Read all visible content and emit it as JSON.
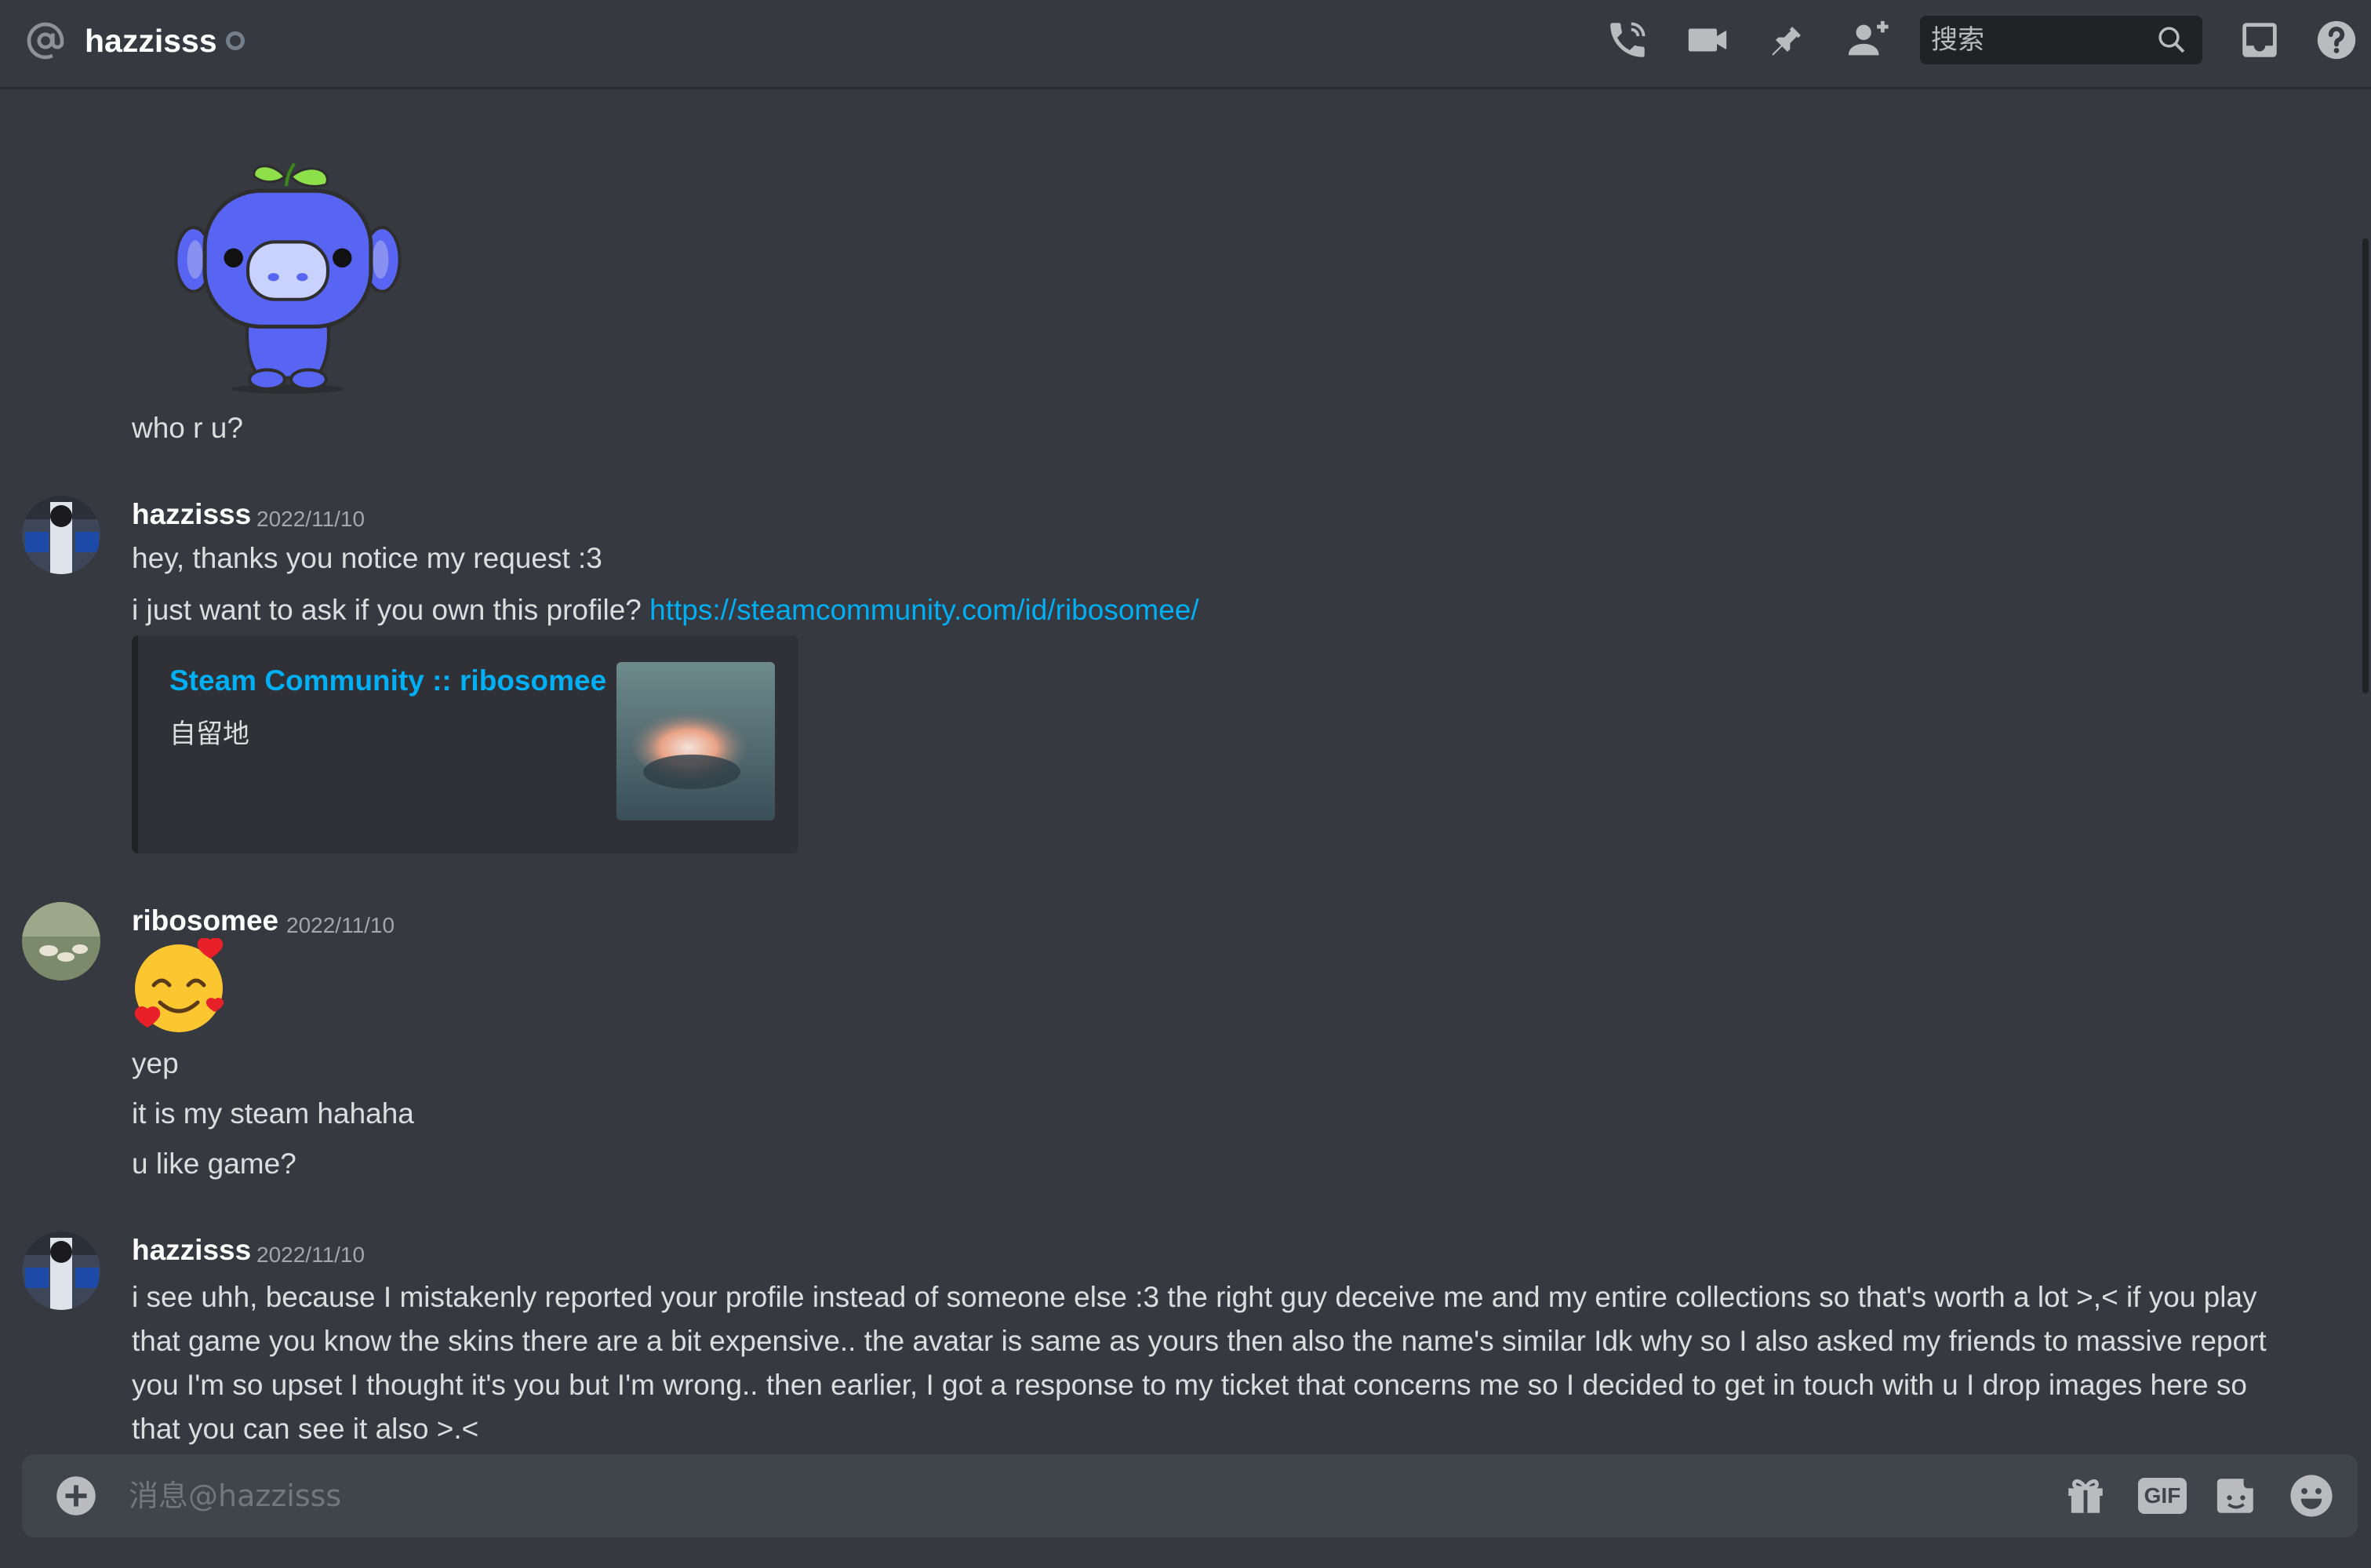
{
  "header": {
    "channel_name": "hazzisss",
    "search_placeholder": "搜索",
    "icons": [
      "at-icon",
      "status-icon",
      "call-icon",
      "video-icon",
      "pin-icon",
      "add-friend-icon",
      "search-icon",
      "inbox-icon",
      "help-icon"
    ]
  },
  "messages": {
    "sticker": {
      "name": "wumpus-sticker",
      "text": "who r u?"
    },
    "group1": {
      "author": "hazzisss",
      "timestamp": "2022/11/10",
      "line1": "hey, thanks you notice my request :3",
      "line2_prefix": "i just want to ask if you own this profile? ",
      "link": "https://steamcommunity.com/id/ribosomee/",
      "embed": {
        "title": "Steam Community :: ribosomee",
        "description": "自留地"
      }
    },
    "group2": {
      "author": "ribosomee",
      "timestamp": "2022/11/10",
      "emoji": "smiling-face-with-hearts",
      "lines": [
        "yep",
        "it is my steam hahaha",
        "u like game?"
      ]
    },
    "group3": {
      "author": "hazzisss",
      "timestamp": "2022/11/10",
      "text": "i see uhh, because I mistakenly reported your profile instead of someone else :3 the right guy deceive me and my entire collections so that's worth a lot >,< if you play that game you know the skins there are a bit expensive.. the avatar is same as yours then also the name's similar Idk why so I also asked my friends to massive report you I'm so upset I thought it's you but I'm wrong.. then earlier, I got a response to my ticket that concerns me so I decided to get in touch with u I drop images here so that you can see it also >.<"
    }
  },
  "composer": {
    "placeholder": "消息@hazzisss",
    "gif_label": "GIF",
    "icons": [
      "add-icon",
      "gift-icon",
      "gif-icon",
      "sticker-icon",
      "emoji-icon"
    ]
  },
  "colors": {
    "background": "#36393f",
    "composer": "#40444b",
    "embed": "#2f3136",
    "link": "#00aff4",
    "text": "#dcddde",
    "muted": "#a3a6aa"
  }
}
